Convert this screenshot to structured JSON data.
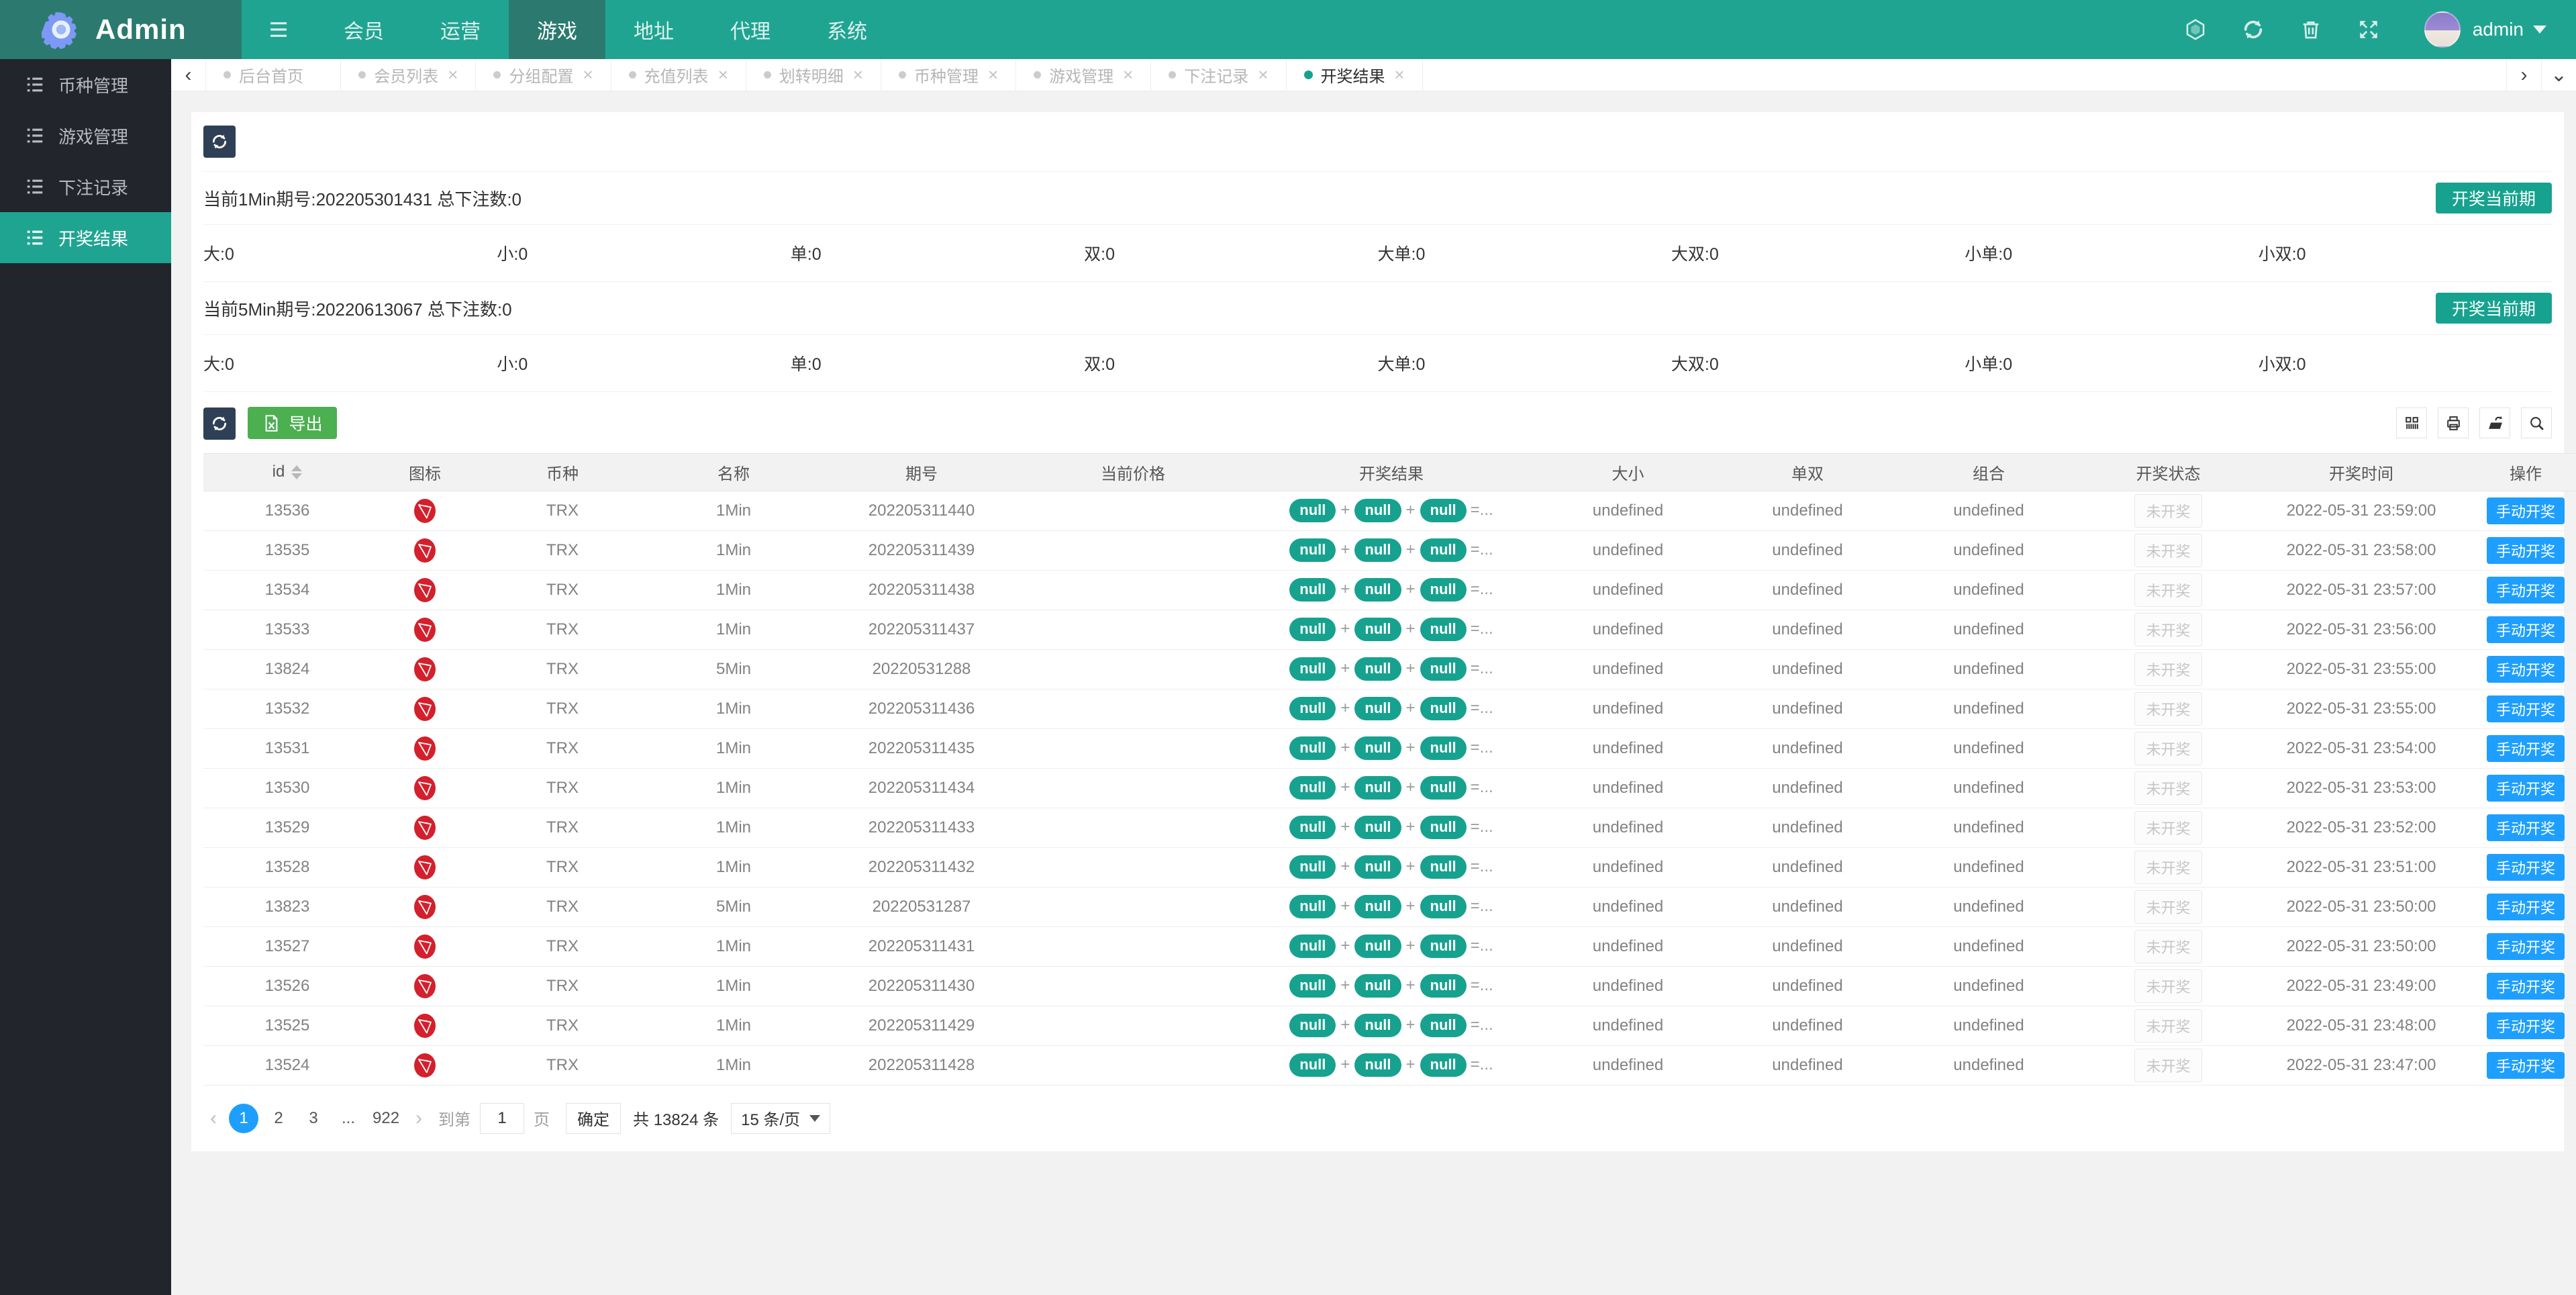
{
  "brand": {
    "name": "Admin"
  },
  "navbar": {
    "items": [
      {
        "label": "会员",
        "active": false
      },
      {
        "label": "运营",
        "active": false
      },
      {
        "label": "游戏",
        "active": true
      },
      {
        "label": "地址",
        "active": false
      },
      {
        "label": "代理",
        "active": false
      },
      {
        "label": "系统",
        "active": false
      }
    ],
    "user": {
      "name": "admin"
    }
  },
  "sidebar": {
    "items": [
      {
        "label": "币种管理",
        "active": false
      },
      {
        "label": "游戏管理",
        "active": false
      },
      {
        "label": "下注记录",
        "active": false
      },
      {
        "label": "开奖结果",
        "active": true
      }
    ]
  },
  "tabs": {
    "items": [
      {
        "label": "后台首页",
        "closable": false,
        "active": false
      },
      {
        "label": "会员列表",
        "closable": true,
        "active": false
      },
      {
        "label": "分组配置",
        "closable": true,
        "active": false
      },
      {
        "label": "充值列表",
        "closable": true,
        "active": false
      },
      {
        "label": "划转明细",
        "closable": true,
        "active": false
      },
      {
        "label": "币种管理",
        "closable": true,
        "active": false
      },
      {
        "label": "游戏管理",
        "closable": true,
        "active": false
      },
      {
        "label": "下注记录",
        "closable": true,
        "active": false
      },
      {
        "label": "开奖结果",
        "closable": true,
        "active": true
      }
    ]
  },
  "panel": {
    "periods": [
      {
        "title": "当前1Min期号:202205301431 总下注数:0",
        "button": "开奖当前期",
        "stats": [
          "大:0",
          "小:0",
          "单:0",
          "双:0",
          "大单:0",
          "大双:0",
          "小单:0",
          "小双:0"
        ]
      },
      {
        "title": "当前5Min期号:20220613067 总下注数:0",
        "button": "开奖当前期",
        "stats": [
          "大:0",
          "小:0",
          "单:0",
          "双:0",
          "大单:0",
          "大双:0",
          "小单:0",
          "小双:0"
        ]
      }
    ],
    "toolbar": {
      "export_label": "导出"
    }
  },
  "table": {
    "columns": [
      "id",
      "图标",
      "币种",
      "名称",
      "期号",
      "当前价格",
      "开奖结果",
      "大小",
      "单双",
      "组合",
      "开奖状态",
      "开奖时间",
      "操作"
    ],
    "result_format": {
      "pill": "null",
      "separator": "+",
      "suffix": "=..."
    },
    "rows": [
      {
        "id": "13536",
        "coin": "TRX",
        "name": "1Min",
        "issue": "202205311440",
        "price": "",
        "bigsmall": "undefined",
        "oddeven": "undefined",
        "combo": "undefined",
        "status": "未开奖",
        "time": "2022-05-31 23:59:00",
        "action": "手动开奖"
      },
      {
        "id": "13535",
        "coin": "TRX",
        "name": "1Min",
        "issue": "202205311439",
        "price": "",
        "bigsmall": "undefined",
        "oddeven": "undefined",
        "combo": "undefined",
        "status": "未开奖",
        "time": "2022-05-31 23:58:00",
        "action": "手动开奖"
      },
      {
        "id": "13534",
        "coin": "TRX",
        "name": "1Min",
        "issue": "202205311438",
        "price": "",
        "bigsmall": "undefined",
        "oddeven": "undefined",
        "combo": "undefined",
        "status": "未开奖",
        "time": "2022-05-31 23:57:00",
        "action": "手动开奖"
      },
      {
        "id": "13533",
        "coin": "TRX",
        "name": "1Min",
        "issue": "202205311437",
        "price": "",
        "bigsmall": "undefined",
        "oddeven": "undefined",
        "combo": "undefined",
        "status": "未开奖",
        "time": "2022-05-31 23:56:00",
        "action": "手动开奖"
      },
      {
        "id": "13824",
        "coin": "TRX",
        "name": "5Min",
        "issue": "20220531288",
        "price": "",
        "bigsmall": "undefined",
        "oddeven": "undefined",
        "combo": "undefined",
        "status": "未开奖",
        "time": "2022-05-31 23:55:00",
        "action": "手动开奖"
      },
      {
        "id": "13532",
        "coin": "TRX",
        "name": "1Min",
        "issue": "202205311436",
        "price": "",
        "bigsmall": "undefined",
        "oddeven": "undefined",
        "combo": "undefined",
        "status": "未开奖",
        "time": "2022-05-31 23:55:00",
        "action": "手动开奖"
      },
      {
        "id": "13531",
        "coin": "TRX",
        "name": "1Min",
        "issue": "202205311435",
        "price": "",
        "bigsmall": "undefined",
        "oddeven": "undefined",
        "combo": "undefined",
        "status": "未开奖",
        "time": "2022-05-31 23:54:00",
        "action": "手动开奖"
      },
      {
        "id": "13530",
        "coin": "TRX",
        "name": "1Min",
        "issue": "202205311434",
        "price": "",
        "bigsmall": "undefined",
        "oddeven": "undefined",
        "combo": "undefined",
        "status": "未开奖",
        "time": "2022-05-31 23:53:00",
        "action": "手动开奖"
      },
      {
        "id": "13529",
        "coin": "TRX",
        "name": "1Min",
        "issue": "202205311433",
        "price": "",
        "bigsmall": "undefined",
        "oddeven": "undefined",
        "combo": "undefined",
        "status": "未开奖",
        "time": "2022-05-31 23:52:00",
        "action": "手动开奖"
      },
      {
        "id": "13528",
        "coin": "TRX",
        "name": "1Min",
        "issue": "202205311432",
        "price": "",
        "bigsmall": "undefined",
        "oddeven": "undefined",
        "combo": "undefined",
        "status": "未开奖",
        "time": "2022-05-31 23:51:00",
        "action": "手动开奖"
      },
      {
        "id": "13823",
        "coin": "TRX",
        "name": "5Min",
        "issue": "20220531287",
        "price": "",
        "bigsmall": "undefined",
        "oddeven": "undefined",
        "combo": "undefined",
        "status": "未开奖",
        "time": "2022-05-31 23:50:00",
        "action": "手动开奖"
      },
      {
        "id": "13527",
        "coin": "TRX",
        "name": "1Min",
        "issue": "202205311431",
        "price": "",
        "bigsmall": "undefined",
        "oddeven": "undefined",
        "combo": "undefined",
        "status": "未开奖",
        "time": "2022-05-31 23:50:00",
        "action": "手动开奖"
      },
      {
        "id": "13526",
        "coin": "TRX",
        "name": "1Min",
        "issue": "202205311430",
        "price": "",
        "bigsmall": "undefined",
        "oddeven": "undefined",
        "combo": "undefined",
        "status": "未开奖",
        "time": "2022-05-31 23:49:00",
        "action": "手动开奖"
      },
      {
        "id": "13525",
        "coin": "TRX",
        "name": "1Min",
        "issue": "202205311429",
        "price": "",
        "bigsmall": "undefined",
        "oddeven": "undefined",
        "combo": "undefined",
        "status": "未开奖",
        "time": "2022-05-31 23:48:00",
        "action": "手动开奖"
      },
      {
        "id": "13524",
        "coin": "TRX",
        "name": "1Min",
        "issue": "202205311428",
        "price": "",
        "bigsmall": "undefined",
        "oddeven": "undefined",
        "combo": "undefined",
        "status": "未开奖",
        "time": "2022-05-31 23:47:00",
        "action": "手动开奖"
      }
    ]
  },
  "pagination": {
    "pages": [
      {
        "label": "1",
        "active": true
      },
      {
        "label": "2",
        "active": false
      },
      {
        "label": "3",
        "active": false
      },
      {
        "label": "...",
        "active": false
      },
      {
        "label": "922",
        "active": false
      }
    ],
    "prev": "‹",
    "next": "›",
    "goto_prefix": "到第",
    "goto_value": "1",
    "goto_suffix": "页",
    "confirm": "确定",
    "total": "共 13824 条",
    "page_size": "15 条/页"
  },
  "colors": {
    "accent": "#20A492",
    "accent_dark": "#2C7A6F",
    "pill": "#17A28F",
    "action_blue": "#1E9FFF",
    "export_green": "#4CAF50",
    "dark_button": "#2F4056",
    "sidebar_bg": "#22252C",
    "trx_red": "#D4202C"
  }
}
